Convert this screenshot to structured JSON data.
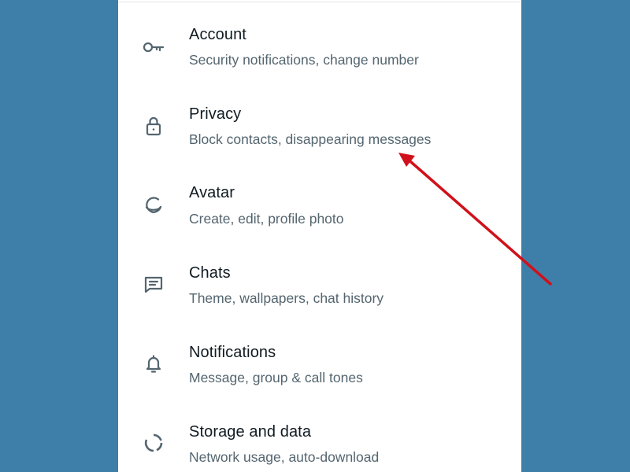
{
  "settings": {
    "items": [
      {
        "title": "Account",
        "subtitle": "Security notifications, change number",
        "icon": "key-icon"
      },
      {
        "title": "Privacy",
        "subtitle": "Block contacts, disappearing messages",
        "icon": "lock-icon"
      },
      {
        "title": "Avatar",
        "subtitle": "Create, edit, profile photo",
        "icon": "avatar-icon"
      },
      {
        "title": "Chats",
        "subtitle": "Theme, wallpapers, chat history",
        "icon": "chat-icon"
      },
      {
        "title": "Notifications",
        "subtitle": "Message, group & call tones",
        "icon": "bell-icon"
      },
      {
        "title": "Storage and data",
        "subtitle": "Network usage, auto-download",
        "icon": "storage-circle-icon"
      }
    ]
  },
  "colors": {
    "background": "#3e7fa9",
    "panel": "#ffffff",
    "title_text": "#111b21",
    "subtitle_text": "#54656f",
    "icon": "#54656f",
    "annotation_arrow": "#d0111b"
  }
}
